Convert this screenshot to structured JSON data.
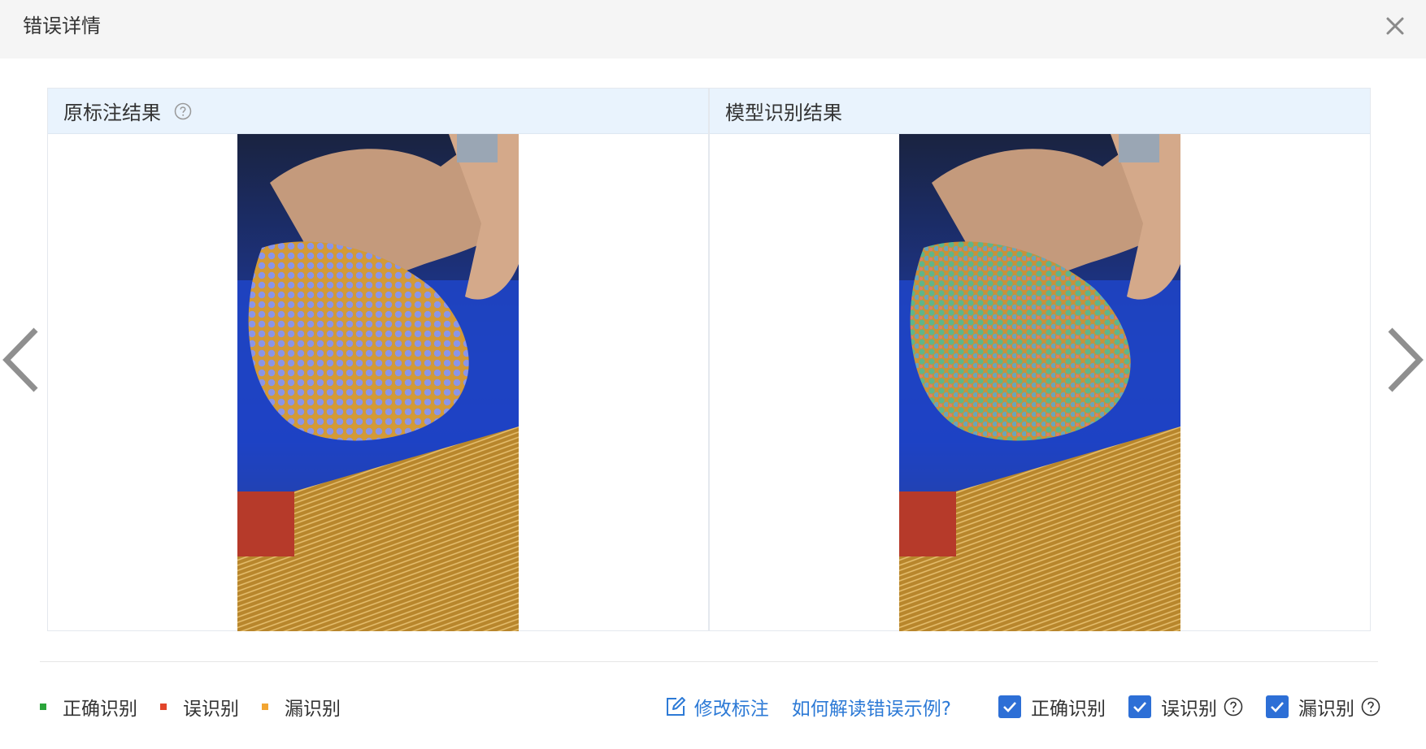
{
  "dialog": {
    "title": "错误详情"
  },
  "panels": {
    "left": {
      "title": "原标注结果"
    },
    "right": {
      "title": "模型识别结果"
    }
  },
  "legend": [
    {
      "label": "正确识别",
      "color": "#2aa43a"
    },
    {
      "label": "误识别",
      "color": "#e2452a"
    },
    {
      "label": "漏识别",
      "color": "#f2a532"
    }
  ],
  "actions": {
    "edit_label": "修改标注",
    "explain_label": "如何解读错误示例?"
  },
  "filters": [
    {
      "label": "正确识别",
      "checked": true
    },
    {
      "label": "误识别",
      "checked": true
    },
    {
      "label": "漏识别",
      "checked": true
    }
  ],
  "colors": {
    "accent": "#2d7ad6",
    "header_bg": "#e9f3fd"
  }
}
